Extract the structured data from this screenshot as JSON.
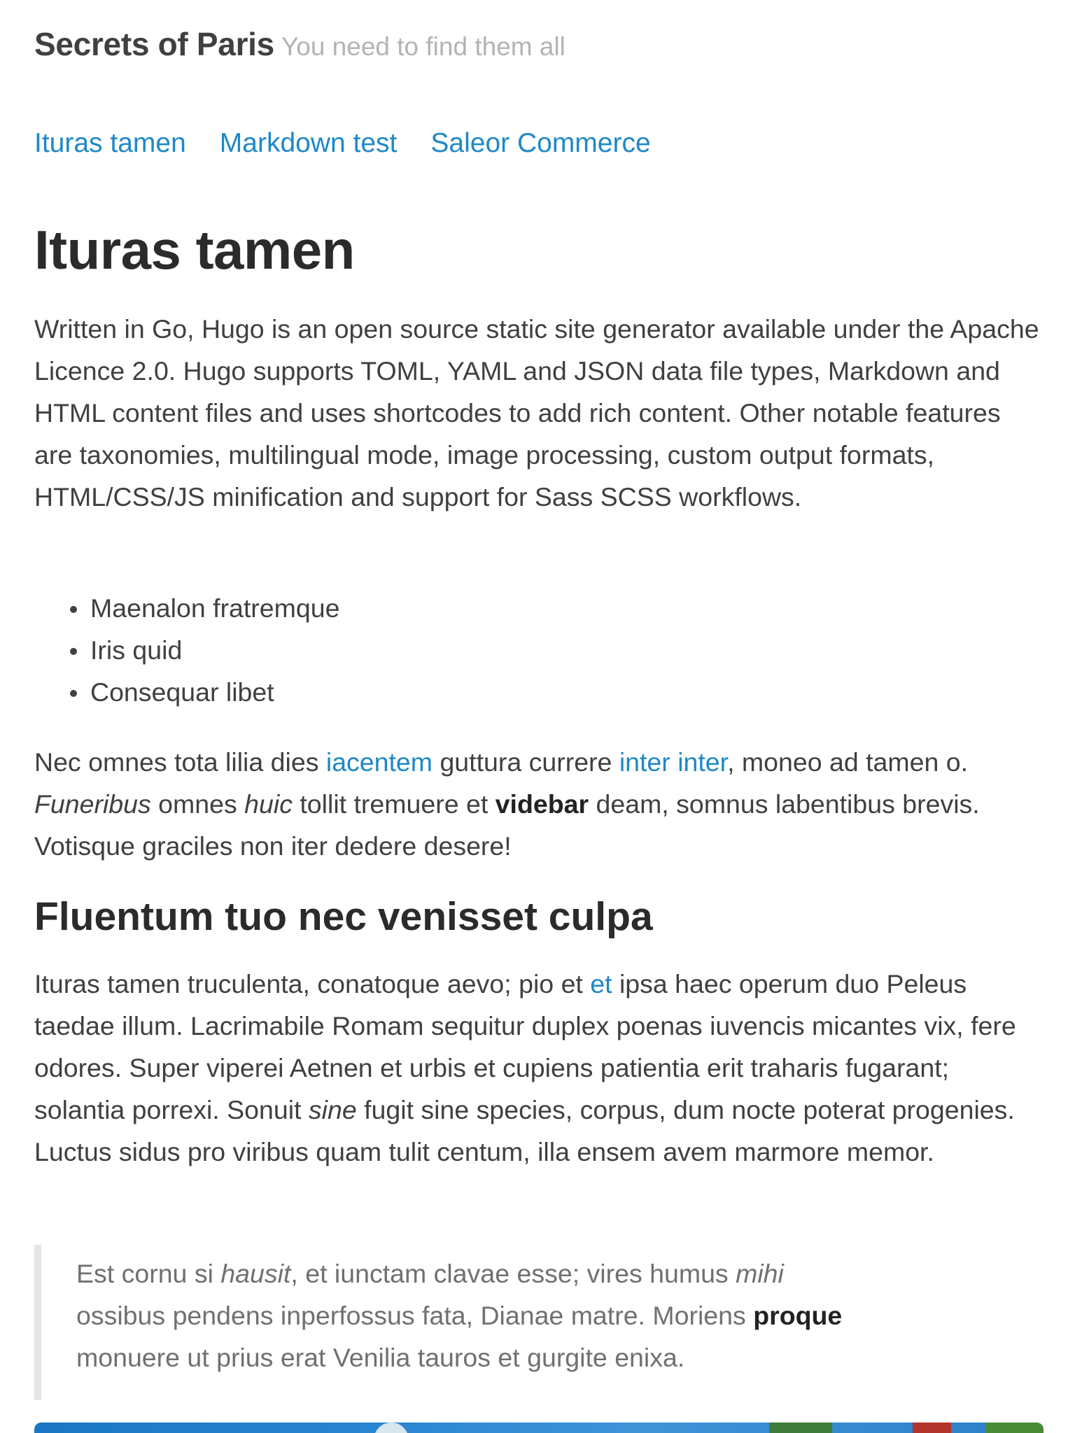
{
  "site": {
    "title": "Secrets of Paris",
    "tagline": "You need to find them all"
  },
  "nav": {
    "items": [
      "Ituras tamen",
      "Markdown test",
      "Saleor Commerce"
    ]
  },
  "article": {
    "title": "Ituras tamen",
    "intro": "Written in Go, Hugo is an open source static site generator available under the Apache Licence 2.0. Hugo supports TOML, YAML and JSON data file types, Markdown and HTML content files and uses shortcodes to add rich content. Other notable features are taxonomies, multilingual mode, image processing, custom output formats, HTML/CSS/JS minification and support for Sass SCSS workflows.",
    "bullets": [
      "Maenalon fratremque",
      "Iris quid",
      "Consequar libet"
    ],
    "para2": {
      "t1": "Nec omnes tota lilia dies ",
      "link1": "iacentem",
      "t2": " guttura currere ",
      "link2": "inter inter",
      "t3": ", moneo ad tamen o. ",
      "em1": "Funeribus",
      "t4": " omnes ",
      "em2": "huic",
      "t5": " tollit tremuere et ",
      "strong1": "videbar",
      "t6": " deam, somnus labentibus brevis. Votisque graciles non iter dedere desere!"
    },
    "section_heading": "Fluentum tuo nec venisset culpa",
    "para3": {
      "t1": "Ituras tamen truculenta, conatoque aevo; pio et ",
      "link1": "et",
      "t2": " ipsa haec operum duo Peleus taedae illum. Lacrimabile Romam sequitur duplex poenas iuvencis micantes vix, fere odores. Super viperei Aetnen et urbis et cupiens patientia erit traharis fugarant; solantia porrexi. Sonuit ",
      "em1": "sine",
      "t3": " fugit sine species, corpus, dum nocte poterat progenies. Luctus sidus pro viribus quam tulit centum, illa ensem avem marmore memor."
    },
    "quote": {
      "t1": "Est cornu si ",
      "em1": "hausit",
      "t2": ", et iunctam clavae esse; vires humus ",
      "em2": "mihi",
      "t3": " ossibus pendens inperfossus fata, Dianae matre. Moriens ",
      "strong1": "proque",
      "t4": " monuere ut prius erat Venilia tauros et gurgite enixa."
    }
  },
  "colors": {
    "link": "#1e88c8",
    "text": "#404040",
    "heading": "#2b2b2b",
    "tagline": "#b3b3b3",
    "quote_text": "#707070",
    "quote_border": "#e5e5e5"
  }
}
